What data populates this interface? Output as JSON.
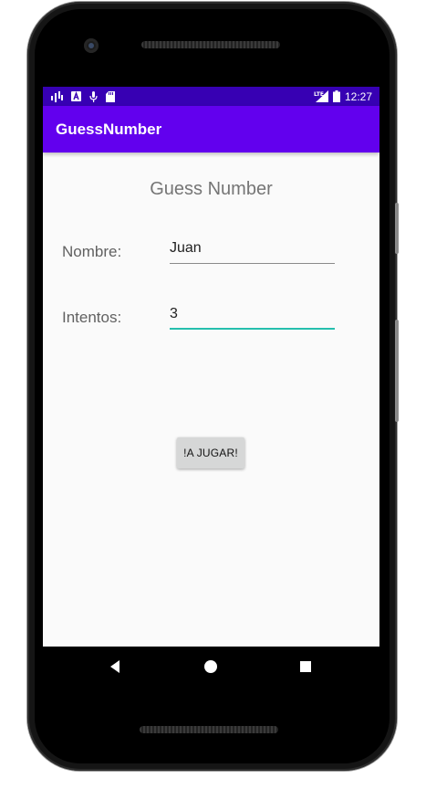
{
  "status_bar": {
    "time": "12:27",
    "left_icons": [
      "signal-activity-icon",
      "notification-a-icon",
      "microphone-icon",
      "sd-card-icon"
    ],
    "right_icons": [
      "lte-signal-icon",
      "battery-icon"
    ],
    "background_color": "#3700b3"
  },
  "app_bar": {
    "title": "GuessNumber",
    "background_color": "#6200ee"
  },
  "main": {
    "heading": "Guess Number",
    "name_label": "Nombre:",
    "name_value": "Juan",
    "attempts_label": "Intentos:",
    "attempts_value": "3",
    "play_button": "!A JUGAR!",
    "focused_field_color": "#26bfad"
  },
  "nav_bar": {
    "icons": [
      "back-icon",
      "home-icon",
      "recents-icon"
    ]
  }
}
